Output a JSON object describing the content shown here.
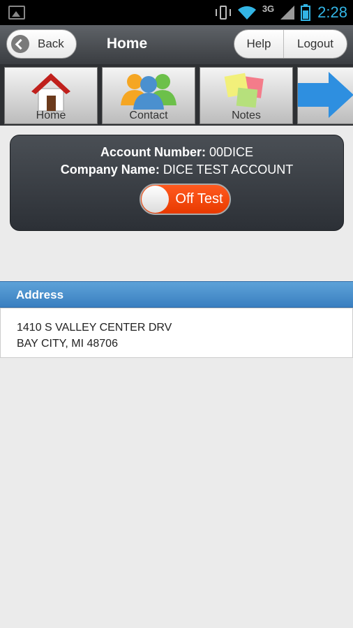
{
  "status_bar": {
    "network": "3G",
    "time": "2:28",
    "icons": [
      "gallery-icon",
      "vibrate-icon",
      "wifi-icon",
      "signal-icon",
      "battery-icon"
    ],
    "accent_color": "#33b5e5"
  },
  "nav": {
    "back_label": "Back",
    "title": "Home",
    "help_label": "Help",
    "logout_label": "Logout"
  },
  "toolbar": {
    "items": [
      {
        "label": "Home",
        "icon": "home-icon"
      },
      {
        "label": "Contact",
        "icon": "contacts-icon"
      },
      {
        "label": "Notes",
        "icon": "notes-icon"
      },
      {
        "label": "",
        "icon": "arrow-right-icon"
      }
    ]
  },
  "account": {
    "number_label": "Account Number:",
    "number_value": "00DICE",
    "company_label": "Company Name:",
    "company_value": "DICE TEST ACCOUNT",
    "toggle_text": "Off Test",
    "toggle_color": "#ff4a10"
  },
  "address": {
    "header": "Address",
    "line1": "1410 S VALLEY CENTER DRV",
    "line2": "BAY CITY, MI 48706",
    "header_color": "#4a90cf"
  }
}
